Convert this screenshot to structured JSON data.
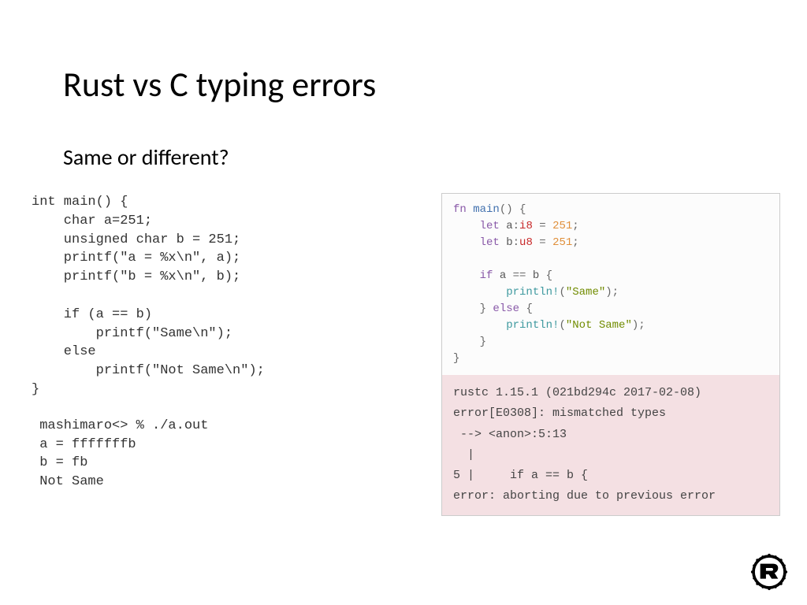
{
  "title": "Rust vs C typing errors",
  "subtitle": "Same or different?",
  "c_code": "int main() {\n    char a=251;\n    unsigned char b = 251;\n    printf(\"a = %x\\n\", a);\n    printf(\"b = %x\\n\", b);\n\n    if (a == b)\n        printf(\"Same\\n\");\n    else\n        printf(\"Not Same\\n\");\n}",
  "c_output": " mashimaro<> % ./a.out\n a = fffffffb\n b = fb\n Not Same",
  "rust_code": {
    "kw_fn": "fn",
    "fn_main": "main",
    "paren_open": "(",
    "paren_close": ")",
    "brace_open": "{",
    "brace_close": "}",
    "kw_let": "let",
    "var_a": "a",
    "colon": ":",
    "ty_i8": "i8",
    "eq": "=",
    "val_251": "251",
    "semi": ";",
    "var_b": "b",
    "ty_u8": "u8",
    "kw_if": "if",
    "eqeq": "==",
    "mac_println": "println!",
    "str_same": "\"Same\"",
    "kw_else": "else",
    "str_notsame": "\"Not Same\""
  },
  "rust_error": "rustc 1.15.1 (021bd294c 2017-02-08)\nerror[E0308]: mismatched types\n --> <anon>:5:13\n  |\n5 |     if a == b {\nerror: aborting due to previous error",
  "logo_name": "rust-logo"
}
